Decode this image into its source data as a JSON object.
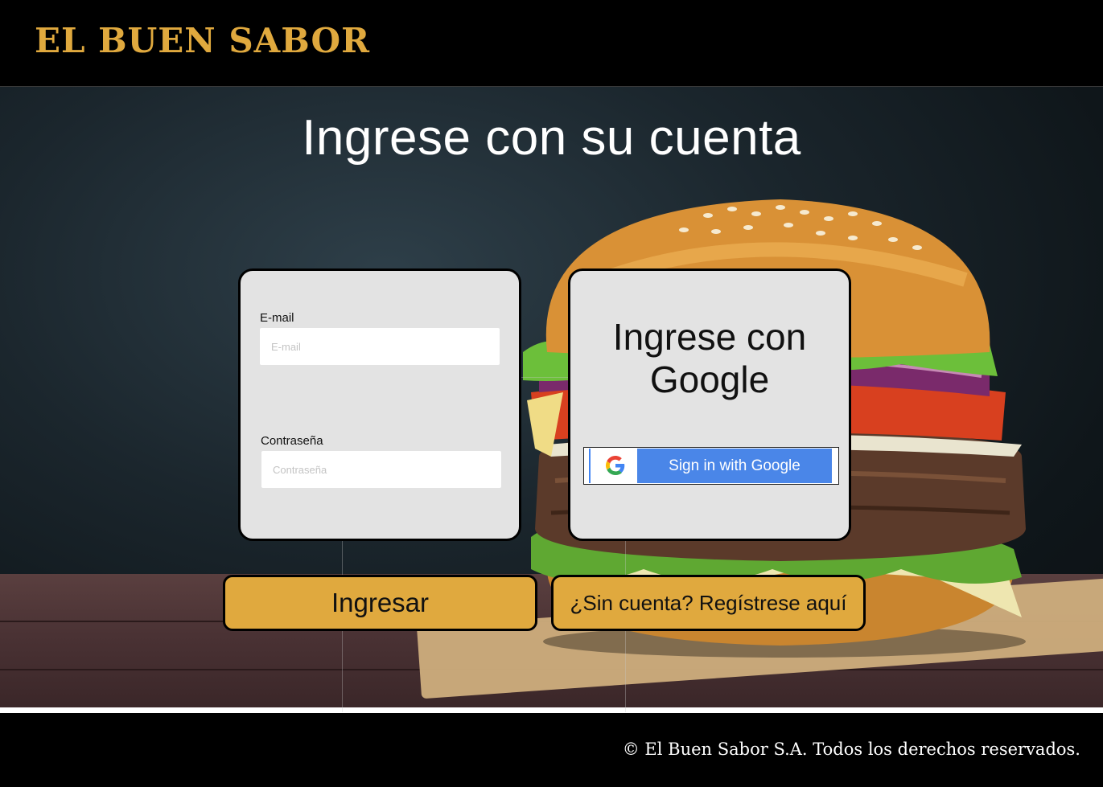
{
  "header": {
    "brand": "EL BUEN SABOR"
  },
  "page": {
    "title": "Ingrese con su cuenta"
  },
  "login_form": {
    "email_label": "E-mail",
    "email_placeholder": "E-mail",
    "password_label": "Contraseña",
    "password_placeholder": "Contraseña"
  },
  "google_panel": {
    "title_line1": "Ingrese con",
    "title_line2": "Google",
    "button_label": "Sign in with Google",
    "button_icon": "google-g-icon"
  },
  "actions": {
    "login_label": "Ingresar",
    "register_label": "¿Sin cuenta? Regístrese aquí"
  },
  "footer": {
    "copyright": "© El Buen Sabor S.A. Todos los derechos reservados."
  },
  "colors": {
    "accent": "#e0a93e",
    "header_bg": "#000000",
    "card_bg": "#e3e3e3",
    "google_blue": "#4a86e8"
  }
}
